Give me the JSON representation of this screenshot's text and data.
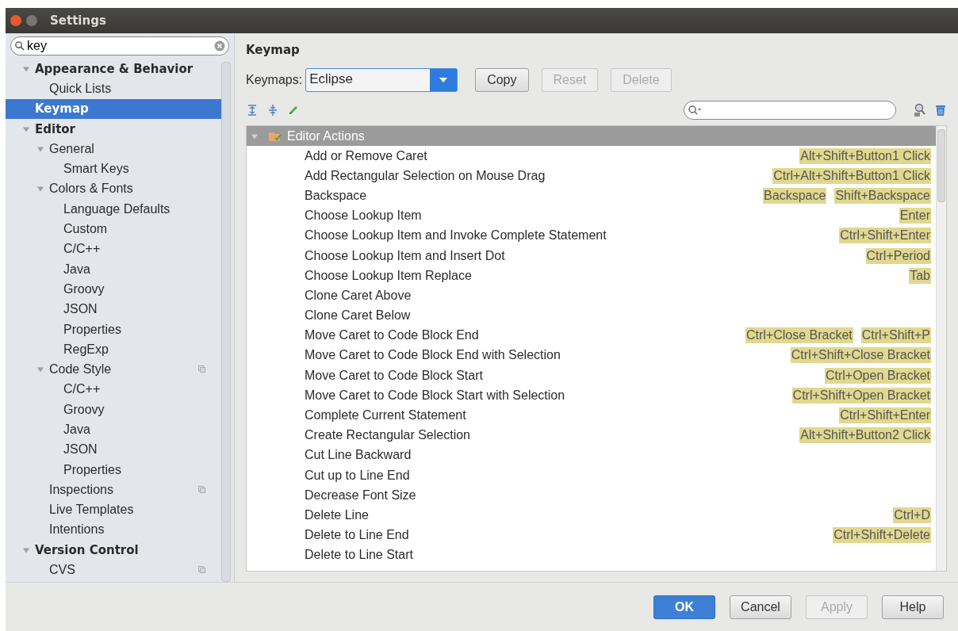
{
  "window": {
    "title": "Settings"
  },
  "search": {
    "value": "key"
  },
  "sidebar": {
    "items": [
      {
        "label": "Appearance & Behavior",
        "kind": "category",
        "expanded": true,
        "selected": false,
        "children": [
          {
            "label": "Quick Lists",
            "selected": false
          }
        ]
      },
      {
        "label": "Keymap",
        "kind": "category",
        "selected": true
      },
      {
        "label": "Editor",
        "kind": "category",
        "expanded": true,
        "selected": false,
        "children": [
          {
            "label": "General",
            "expanded": true,
            "selected": false,
            "children": [
              {
                "label": "Smart Keys",
                "selected": false
              }
            ]
          },
          {
            "label": "Colors & Fonts",
            "expanded": true,
            "selected": false,
            "children": [
              {
                "label": "Language Defaults",
                "selected": false
              },
              {
                "label": "Custom",
                "selected": false
              },
              {
                "label": "C/C++",
                "selected": false
              },
              {
                "label": "Java",
                "selected": false
              },
              {
                "label": "Groovy",
                "selected": false
              },
              {
                "label": "JSON",
                "selected": false
              },
              {
                "label": "Properties",
                "selected": false
              },
              {
                "label": "RegExp",
                "selected": false
              }
            ]
          },
          {
            "label": "Code Style",
            "expanded": true,
            "selected": false,
            "project_level": true,
            "children": [
              {
                "label": "C/C++",
                "selected": false
              },
              {
                "label": "Groovy",
                "selected": false
              },
              {
                "label": "Java",
                "selected": false
              },
              {
                "label": "JSON",
                "selected": false
              },
              {
                "label": "Properties",
                "selected": false
              }
            ]
          },
          {
            "label": "Inspections",
            "selected": false,
            "project_level": true
          },
          {
            "label": "Live Templates",
            "selected": false
          },
          {
            "label": "Intentions",
            "selected": false
          }
        ]
      },
      {
        "label": "Version Control",
        "kind": "category",
        "expanded": true,
        "selected": false,
        "children": [
          {
            "label": "CVS",
            "selected": false,
            "project_level": true
          }
        ]
      }
    ]
  },
  "panel": {
    "title": "Keymap",
    "keymaps_label": "Keymaps:",
    "keymap": "Eclipse",
    "buttons": [
      {
        "label": "Copy",
        "disabled": false
      },
      {
        "label": "Reset",
        "disabled": true
      },
      {
        "label": "Delete",
        "disabled": true
      }
    ],
    "group": {
      "label": "Editor Actions",
      "expanded": true,
      "selected": true
    },
    "actions": [
      {
        "name": "Add or Remove Caret",
        "shortcuts": [
          "Alt+Shift+Button1 Click"
        ]
      },
      {
        "name": "Add Rectangular Selection on Mouse Drag",
        "shortcuts": [
          "Ctrl+Alt+Shift+Button1 Click"
        ]
      },
      {
        "name": "Backspace",
        "shortcuts": [
          "Backspace",
          "Shift+Backspace"
        ]
      },
      {
        "name": "Choose Lookup Item",
        "shortcuts": [
          "Enter"
        ]
      },
      {
        "name": "Choose Lookup Item and Invoke Complete Statement",
        "shortcuts": [
          "Ctrl+Shift+Enter"
        ]
      },
      {
        "name": "Choose Lookup Item and Insert Dot",
        "shortcuts": [
          "Ctrl+Period"
        ]
      },
      {
        "name": "Choose Lookup Item Replace",
        "shortcuts": [
          "Tab"
        ]
      },
      {
        "name": "Clone Caret Above"
      },
      {
        "name": "Clone Caret Below"
      },
      {
        "name": "Move Caret to Code Block End",
        "shortcuts": [
          "Ctrl+Close Bracket",
          "Ctrl+Shift+P"
        ]
      },
      {
        "name": "Move Caret to Code Block End with Selection",
        "shortcuts": [
          "Ctrl+Shift+Close Bracket"
        ]
      },
      {
        "name": "Move Caret to Code Block Start",
        "shortcuts": [
          "Ctrl+Open Bracket"
        ]
      },
      {
        "name": "Move Caret to Code Block Start with Selection",
        "shortcuts": [
          "Ctrl+Shift+Open Bracket"
        ]
      },
      {
        "name": "Complete Current Statement",
        "shortcuts": [
          "Ctrl+Shift+Enter"
        ]
      },
      {
        "name": "Create Rectangular Selection",
        "shortcuts": [
          "Alt+Shift+Button2 Click"
        ]
      },
      {
        "name": "Cut Line Backward"
      },
      {
        "name": "Cut up to Line End"
      },
      {
        "name": "Decrease Font Size"
      },
      {
        "name": "Delete Line",
        "shortcuts": [
          "Ctrl+D"
        ]
      },
      {
        "name": "Delete to Line End",
        "shortcuts": [
          "Ctrl+Shift+Delete"
        ]
      },
      {
        "name": "Delete to Line Start"
      }
    ]
  },
  "footer": {
    "buttons": [
      {
        "label": "OK",
        "kind": "default",
        "disabled": false
      },
      {
        "label": "Cancel",
        "kind": "normal",
        "disabled": false
      },
      {
        "label": "Apply",
        "kind": "normal",
        "disabled": true
      },
      {
        "label": "Help",
        "kind": "normal",
        "disabled": false
      }
    ]
  }
}
